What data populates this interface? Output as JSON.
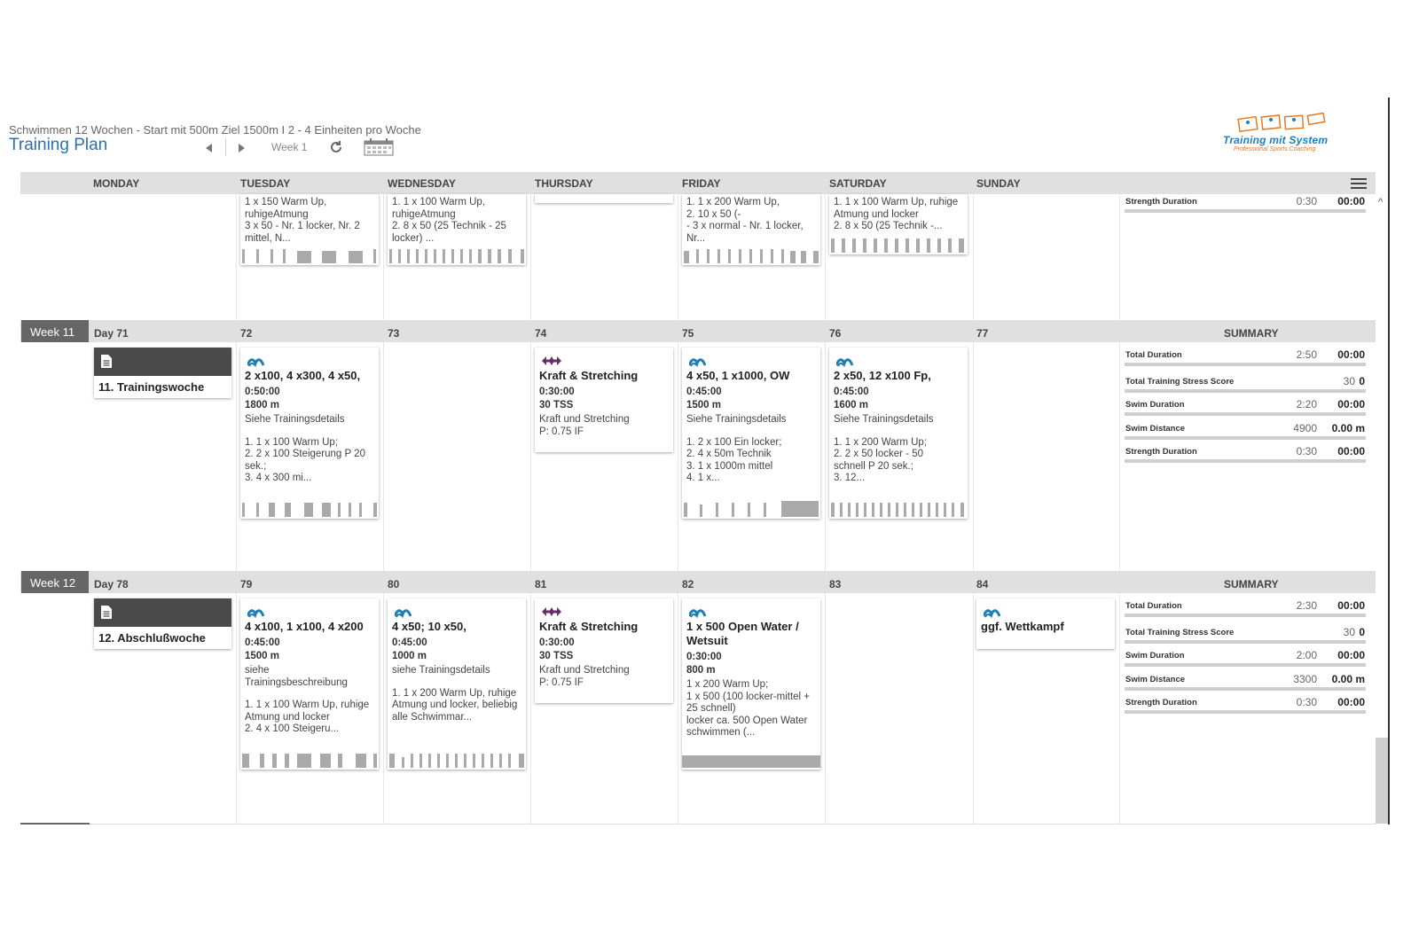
{
  "header": {
    "subtitle": "Schwimmen 12 Wochen - Start mit 500m Ziel 1500m I 2 - 4 Einheiten pro Woche",
    "title": "Training Plan",
    "week_label": "Week 1"
  },
  "logo": {
    "text": "Training mit System",
    "sub": "Professional Sports Coaching"
  },
  "days": [
    "MONDAY",
    "TUESDAY",
    "WEDNESDAY",
    "THURSDAY",
    "FRIDAY",
    "SATURDAY",
    "SUNDAY"
  ],
  "summary_label": "SUMMARY",
  "top_row": {
    "tue": "1 x 150 Warm Up,\nruhigeAtmung\n3 x  50 - Nr. 1 locker, Nr. 2\nmittel, N...",
    "wed": "1. 1 x 100 Warm Up,\nruhigeAtmung\n2. 8 x  50 (25 Technik - 25\nlocker) ...",
    "fri": "1. 1 x 200 Warm Up,\n2. 10 x  50 (-\n- 3 x normal - Nr. 1 locker,\nNr...",
    "sat": "1. 1 x 100 Warm Up, ruhige\nAtmung und locker\n2. 8 x  50 (25 Technik -...",
    "summary": {
      "label": "Strength Duration",
      "v1": "0:30",
      "v2": "00:00"
    }
  },
  "week11": {
    "tag": "Week 11",
    "days": [
      "Day 71",
      "72",
      "73",
      "74",
      "75",
      "76",
      "77"
    ],
    "note": "11. Trainingswoche",
    "tue": {
      "title": "2 x100, 4 x300, 4 x50,",
      "dur": "0:50:00",
      "dist": "1800 m",
      "desc": "Siehe Trainingsdetails",
      "detail": "1. 1 x 100 Warm Up;\n2. 2 x 100 Steigerung P 20\nsek.;\n3. 4 x  300 mi..."
    },
    "thu": {
      "title": "Kraft & Stretching",
      "dur": "0:30:00",
      "tss": "30 TSS",
      "desc": "Kraft und Stretching\nP: 0.75 IF"
    },
    "fri": {
      "title": "4 x50, 1 x1000, OW",
      "dur": "0:45:00",
      "dist": "1500 m",
      "desc": "Siehe Trainingsdetails",
      "detail": "1. 2 x 100 Ein locker;\n2. 4 x 50m Technik\n3. 1 x 1000m mittel\n4. 1 x..."
    },
    "sat": {
      "title": "2 x50, 12 x100 Fp,",
      "dur": "0:45:00",
      "dist": "1600 m",
      "desc": "Siehe Trainingsdetails",
      "detail": "1. 1 x 200 Warm Up;\n2. 2 x  50 locker - 50\nschnell P 20 sek.;\n3. 12..."
    },
    "summary": [
      {
        "label": "Total Duration",
        "v1": "2:50",
        "v2": "00:00"
      },
      {
        "label": "Total Training Stress Score",
        "v1": "30",
        "v2": "0"
      },
      {
        "label": "Swim Duration",
        "v1": "2:20",
        "v2": "00:00"
      },
      {
        "label": "Swim Distance",
        "v1": "4900",
        "v2": "0.00 m"
      },
      {
        "label": "Strength Duration",
        "v1": "0:30",
        "v2": "00:00"
      }
    ]
  },
  "week12": {
    "tag": "Week 12",
    "days": [
      "Day 78",
      "79",
      "80",
      "81",
      "82",
      "83",
      "84"
    ],
    "note": "12. Abschlußwoche",
    "tue": {
      "title": "4 x100, 1 x100, 4 x200",
      "dur": "0:45:00",
      "dist": "1500 m",
      "desc": "siehe\nTrainingsbeschreibung",
      "detail": "1. 1 x 100 Warm Up, ruhige\nAtmung und locker\n2. 4 x 100 Steigeru..."
    },
    "wed": {
      "title": "4 x50; 10 x50,",
      "dur": "0:45:00",
      "dist": "1000 m",
      "desc": "siehe Trainingsdetails",
      "detail": "1. 1 x 200 Warm Up, ruhige\nAtmung und locker, beliebig\nalle Schwimmar..."
    },
    "thu": {
      "title": "Kraft & Stretching",
      "dur": "0:30:00",
      "tss": "30 TSS",
      "desc": "Kraft und Stretching\nP: 0.75 IF"
    },
    "fri": {
      "title": "1 x 500 Open Water /\nWetsuit",
      "dur": "0:30:00",
      "dist": "800 m",
      "desc": "1 x 200 Warm Up;\n1 x 500 (100 locker-mittel +\n25 schnell)\nlocker ca. 500 Open Water\nschwimmen (..."
    },
    "sun": {
      "title": "ggf. Wettkampf"
    },
    "summary": [
      {
        "label": "Total Duration",
        "v1": "2:30",
        "v2": "00:00"
      },
      {
        "label": "Total Training Stress Score",
        "v1": "30",
        "v2": "0"
      },
      {
        "label": "Swim Duration",
        "v1": "2:00",
        "v2": "00:00"
      },
      {
        "label": "Swim Distance",
        "v1": "3300",
        "v2": "0.00 m"
      },
      {
        "label": "Strength Duration",
        "v1": "0:30",
        "v2": "00:00"
      }
    ]
  },
  "icons": {
    "swim": "swim-icon",
    "strength": "dumbbell-icon",
    "note": "document-icon"
  },
  "colors": {
    "swim": "#1d7fb3",
    "strength": "#6b2c6b",
    "title_blue": "#2a6fb0",
    "week_tag": "#666666"
  }
}
